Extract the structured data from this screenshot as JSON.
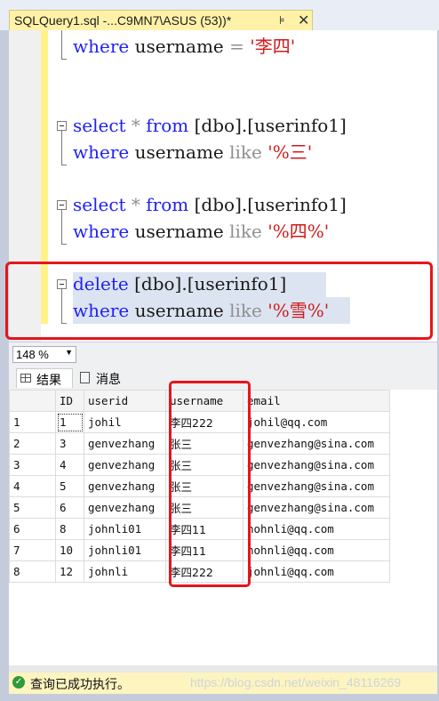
{
  "tab": {
    "title": "SQLQuery1.sql -...C9MN7\\ASUS (53))*",
    "pin": "⊧",
    "close": "✕"
  },
  "editor": {
    "line1": {
      "kw": "where",
      "rest": " username ",
      "op": "=",
      "str": " '李四'"
    },
    "block1": {
      "select": "select",
      "star": " * ",
      "from": "from",
      "table": " [dbo].[userinfo1]",
      "where": "where",
      "col": " username ",
      "like": "like",
      "pattern": " '%三'"
    },
    "block2": {
      "select": "select",
      "star": " * ",
      "from": "from",
      "table": " [dbo].[userinfo1]",
      "where": "where",
      "col": " username ",
      "like": "like",
      "pattern": " '%四%'"
    },
    "block3": {
      "delete": "delete",
      "table": " [dbo].[userinfo1]",
      "where": "where",
      "col": " username ",
      "like": "like",
      "pattern": " '%雪%'"
    }
  },
  "zoom": {
    "value": "148 %"
  },
  "results_tabs": {
    "results": "结果",
    "messages": "消息"
  },
  "grid": {
    "headers": [
      "",
      "ID",
      "userid",
      "username",
      "email"
    ],
    "rows": [
      [
        "1",
        "1",
        "johil",
        "李四222",
        "johil@qq.com"
      ],
      [
        "2",
        "3",
        "genvezhang",
        "张三",
        "genvezhang@sina.com"
      ],
      [
        "3",
        "4",
        "genvezhang",
        "张三",
        "genvezhang@sina.com"
      ],
      [
        "4",
        "5",
        "genvezhang",
        "张三",
        "genvezhang@sina.com"
      ],
      [
        "5",
        "6",
        "genvezhang",
        "张三",
        "genvezhang@sina.com"
      ],
      [
        "6",
        "8",
        "johnli01",
        "李四11",
        "hohnli@qq.com"
      ],
      [
        "7",
        "10",
        "johnli01",
        "李四11",
        "hohnli@qq.com"
      ],
      [
        "8",
        "12",
        "johnli",
        "李四222",
        "johnli@qq.com"
      ]
    ]
  },
  "status": {
    "text": "查询已成功执行。",
    "watermark": "https://blog.csdn.net/weixin_48116269"
  },
  "colors": {
    "keyword": "#1f1ff5",
    "string": "#d01b1b",
    "highlight": "#e6151c",
    "tab": "#fff2a8",
    "status": "#fdf4c0"
  }
}
